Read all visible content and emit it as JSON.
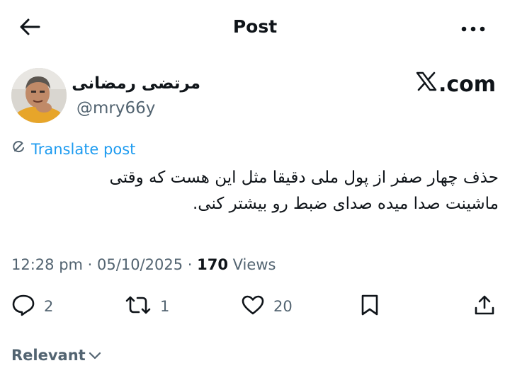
{
  "header": {
    "title": "Post",
    "back_icon": "arrow-left-icon",
    "more_icon": "more-horizontal-icon"
  },
  "author": {
    "display_name": "مرتضی رمضانی",
    "handle": "@mry66y"
  },
  "brand": {
    "logo_icon": "x-logo-icon",
    "suffix": ".com"
  },
  "translate": {
    "label": "Translate post",
    "icon": "translate-icon"
  },
  "tweet": {
    "text": "حذف چهار صفر از پول ملی دقیقا مثل این هست که وقتی\nماشینت صدا میده صدای ضبط رو بیشتر کنی."
  },
  "meta": {
    "time": "12:28 pm",
    "date": "05/10/2025",
    "views_count": "170",
    "views_label": "Views"
  },
  "actions": {
    "replies": "2",
    "reposts": "1",
    "likes": "20"
  },
  "sort": {
    "label": "Relevant"
  },
  "colors": {
    "accent": "#1d9bf0",
    "text": "#0f1419",
    "secondary": "#536471",
    "background": "#ffffff"
  }
}
